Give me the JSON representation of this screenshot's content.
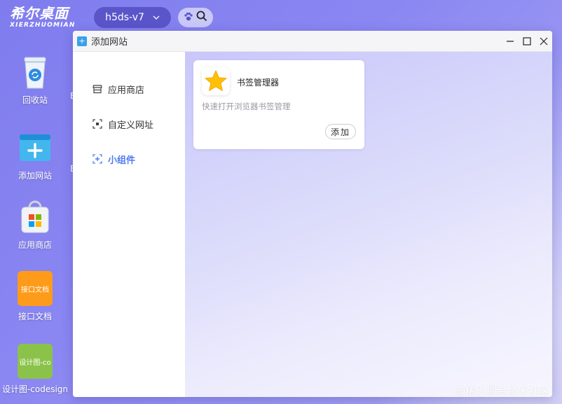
{
  "topbar": {
    "logo_main": "希尔桌面",
    "logo_sub": "XIERZHUOMIAN",
    "workspace": "h5ds-v7",
    "icons": [
      "chevron-down-icon",
      "paw-icon",
      "search-icon"
    ]
  },
  "desktop": {
    "icons": [
      {
        "label": "回收站",
        "icon": "recycle-bin-icon"
      },
      {
        "label": "添加网站",
        "icon": "add-website-icon"
      },
      {
        "label": "应用商店",
        "icon": "app-store-icon"
      },
      {
        "label": "接口文档",
        "tile_text": "接口文档",
        "color": "#ff9b1a"
      },
      {
        "label": "设计图-codesign",
        "tile_text": "设计图-co",
        "color": "#8bc34a"
      }
    ],
    "peek_chars": [
      "E",
      "E"
    ]
  },
  "window": {
    "title": "添加网站",
    "controls": {
      "minimize": "—",
      "maximize": "☐",
      "close": "✕"
    },
    "sidebar": {
      "items": [
        {
          "label": "应用商店",
          "icon": "store-icon",
          "active": false
        },
        {
          "label": "自定义网址",
          "icon": "custom-url-icon",
          "active": false
        },
        {
          "label": "小组件",
          "icon": "widget-icon",
          "active": true
        }
      ]
    },
    "card": {
      "title": "书签管理器",
      "description": "快速打开浏览器书签管理",
      "add_label": "添加",
      "icon": "star-icon"
    }
  },
  "watermark": "@稀土掘金技术社区",
  "colors": {
    "desktop_bg": "#8a86f2",
    "accent": "#4f7cf0",
    "workspace_pill": "#5a55c9"
  }
}
